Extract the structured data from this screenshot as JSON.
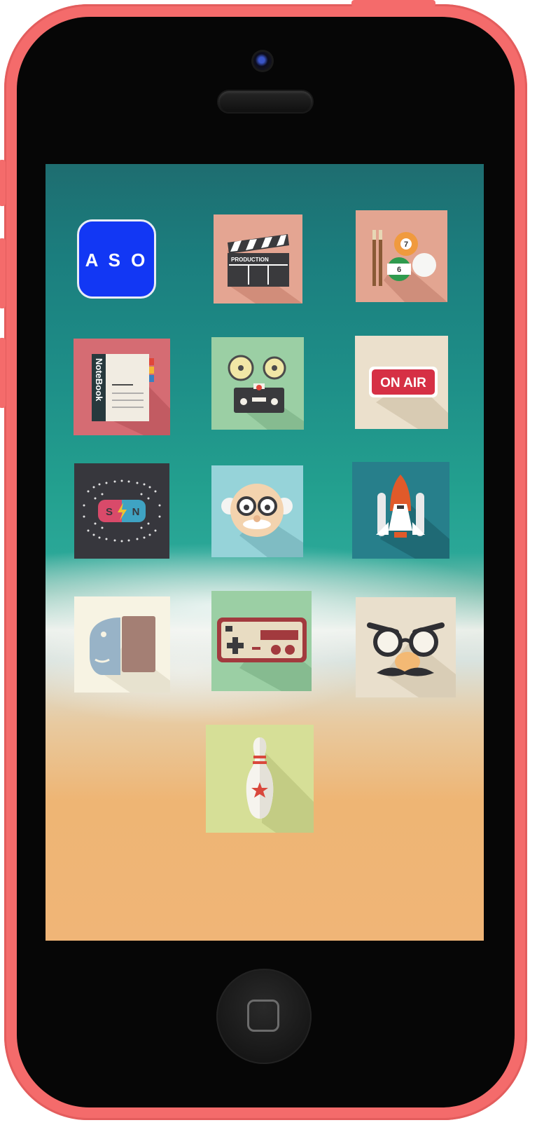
{
  "device": {
    "frame_color": "#f46b6b",
    "model": "iPhone 5c"
  },
  "home_screen": {
    "apps": [
      {
        "name": "aso-app",
        "text": "A S O",
        "icon": "aso-logo",
        "bg": "#1237f4"
      },
      {
        "name": "production-app",
        "text": "PRODUCTION",
        "icon": "clapperboard",
        "bg": "#e4a592"
      },
      {
        "name": "billiards-app",
        "icon": "billiard-balls",
        "bg": "#e3a591",
        "ball_numbers": [
          "7",
          "6"
        ]
      },
      {
        "name": "notebook-app",
        "text": "NoteBook",
        "icon": "notebook",
        "bg": "#d56c73"
      },
      {
        "name": "film-projector-app",
        "icon": "film-projector",
        "bg": "#9bcfa4"
      },
      {
        "name": "on-air-app",
        "text": "ON AIR",
        "icon": "on-air-sign",
        "bg": "#ebe0cc"
      },
      {
        "name": "magnet-app",
        "text_left": "S",
        "text_right": "N",
        "icon": "magnet",
        "bg": "#37373d"
      },
      {
        "name": "professor-app",
        "icon": "professor-face",
        "bg": "#96d3d9"
      },
      {
        "name": "space-shuttle-app",
        "icon": "space-shuttle",
        "bg": "#277f8b"
      },
      {
        "name": "evernote-elephant-app",
        "icon": "elephant",
        "bg": "#f7f3e3"
      },
      {
        "name": "game-controller-app",
        "icon": "game-controller",
        "bg": "#9bcfa4"
      },
      {
        "name": "disguise-app",
        "icon": "disguise-glasses",
        "bg": "#e9dfcc"
      },
      {
        "name": "bowling-app",
        "icon": "bowling-pin",
        "bg": "#d6df97"
      }
    ]
  }
}
